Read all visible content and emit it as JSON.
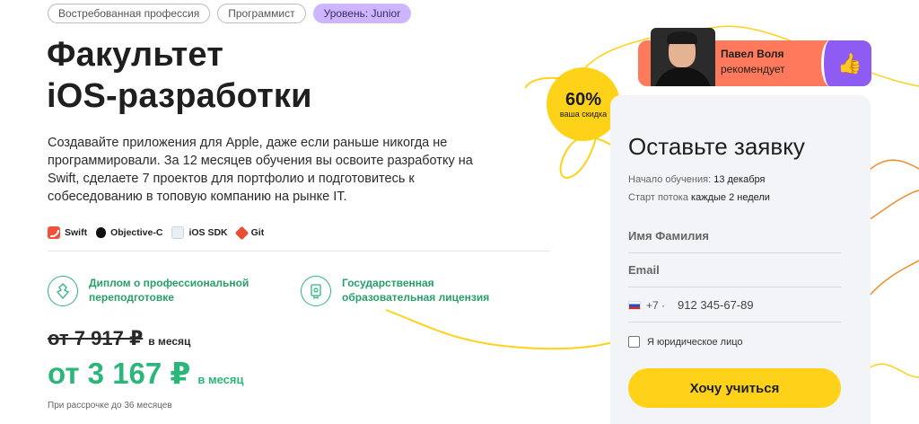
{
  "tags": [
    "Востребованная профессия",
    "Программист",
    "Уровень: Junior"
  ],
  "title": [
    "Факультет",
    "iOS-разработки"
  ],
  "description": "Создавайте приложения для Apple, даже если раньше никогда не программировали. За 12 месяцев обучения вы освоите разработку на Swift, сделаете 7 проектов для портфолио и подготовитесь к собеседованию в топовую компанию на рынке IT.",
  "technologies": [
    {
      "label": "Swift",
      "icon": "swift-icon"
    },
    {
      "label": "Objective-C",
      "icon": "apple-icon"
    },
    {
      "label": "iOS SDK",
      "icon": "ios-sdk-icon"
    },
    {
      "label": "Git",
      "icon": "git-icon"
    }
  ],
  "features": [
    {
      "text": "Диплом о профессиональной переподготовке",
      "icon": "emblem-icon"
    },
    {
      "text": "Государственная образовательная лицензия",
      "icon": "license-icon"
    }
  ],
  "price": {
    "old": "от 7 917 ₽",
    "old_period": "в месяц",
    "new": "от 3 167 ₽",
    "new_period": "в месяц",
    "note": "При рассрочке до 36 месяцев"
  },
  "discount": {
    "percent": "60%",
    "label": "ваша скидка"
  },
  "recommendation": {
    "name": "Павел Воля",
    "text": "рекомендует",
    "icon": "thumbs-up-icon"
  },
  "form": {
    "title": "Оставьте заявку",
    "start_label": "Начало обучения:",
    "start_value": "13 декабря",
    "stream_label": "Старт потока",
    "stream_value": "каждые 2 недели",
    "name_placeholder": "Имя Фамилия",
    "email_placeholder": "Email",
    "phone_prefix": "+7 ·",
    "phone_placeholder": "912 345-67-89",
    "legal_checkbox": "Я юридическое лицо",
    "submit": "Хочу учиться"
  },
  "colors": {
    "accent_green": "#2cb67a",
    "yellow": "#ffd21a",
    "purple": "#8e5cf2",
    "coral": "#ff7a5c"
  }
}
